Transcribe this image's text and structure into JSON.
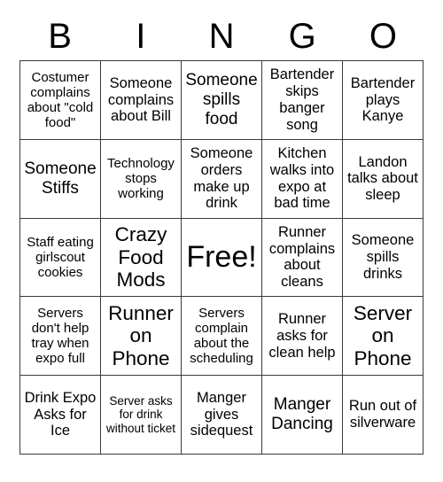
{
  "card": {
    "header_letters": [
      "B",
      "I",
      "N",
      "G",
      "O"
    ],
    "free_space_label": "Free!",
    "rows": [
      [
        {
          "text": "Costumer complains about \"cold food\"",
          "size": "sm"
        },
        {
          "text": "Someone complains about Bill",
          "size": "md"
        },
        {
          "text": "Someone spills food",
          "size": "lg"
        },
        {
          "text": "Bartender skips banger song",
          "size": "md"
        },
        {
          "text": "Bartender plays Kanye",
          "size": "md"
        }
      ],
      [
        {
          "text": "Someone Stiffs",
          "size": "lg"
        },
        {
          "text": "Technology stops working",
          "size": "sm"
        },
        {
          "text": "Someone orders make up drink",
          "size": "md"
        },
        {
          "text": "Kitchen walks into expo at bad time",
          "size": "md"
        },
        {
          "text": "Landon talks about sleep",
          "size": "md"
        }
      ],
      [
        {
          "text": "Staff eating girlscout cookies",
          "size": "sm"
        },
        {
          "text": "Crazy Food Mods",
          "size": "xl"
        },
        {
          "text": "Free!",
          "size": "free"
        },
        {
          "text": "Runner complains about cleans",
          "size": "md"
        },
        {
          "text": "Someone spills drinks",
          "size": "md"
        }
      ],
      [
        {
          "text": "Servers don't help tray when expo full",
          "size": "sm"
        },
        {
          "text": "Runner on Phone",
          "size": "xl"
        },
        {
          "text": "Servers complain about the scheduling",
          "size": "sm"
        },
        {
          "text": "Runner asks for clean help",
          "size": "md"
        },
        {
          "text": "Server on Phone",
          "size": "xl"
        }
      ],
      [
        {
          "text": "Drink Expo Asks for Ice",
          "size": "md"
        },
        {
          "text": "Server asks for drink without ticket",
          "size": "xs"
        },
        {
          "text": "Manger gives sidequest",
          "size": "md"
        },
        {
          "text": "Manger Dancing",
          "size": "lg"
        },
        {
          "text": "Run out of silverware",
          "size": "md"
        }
      ]
    ]
  }
}
